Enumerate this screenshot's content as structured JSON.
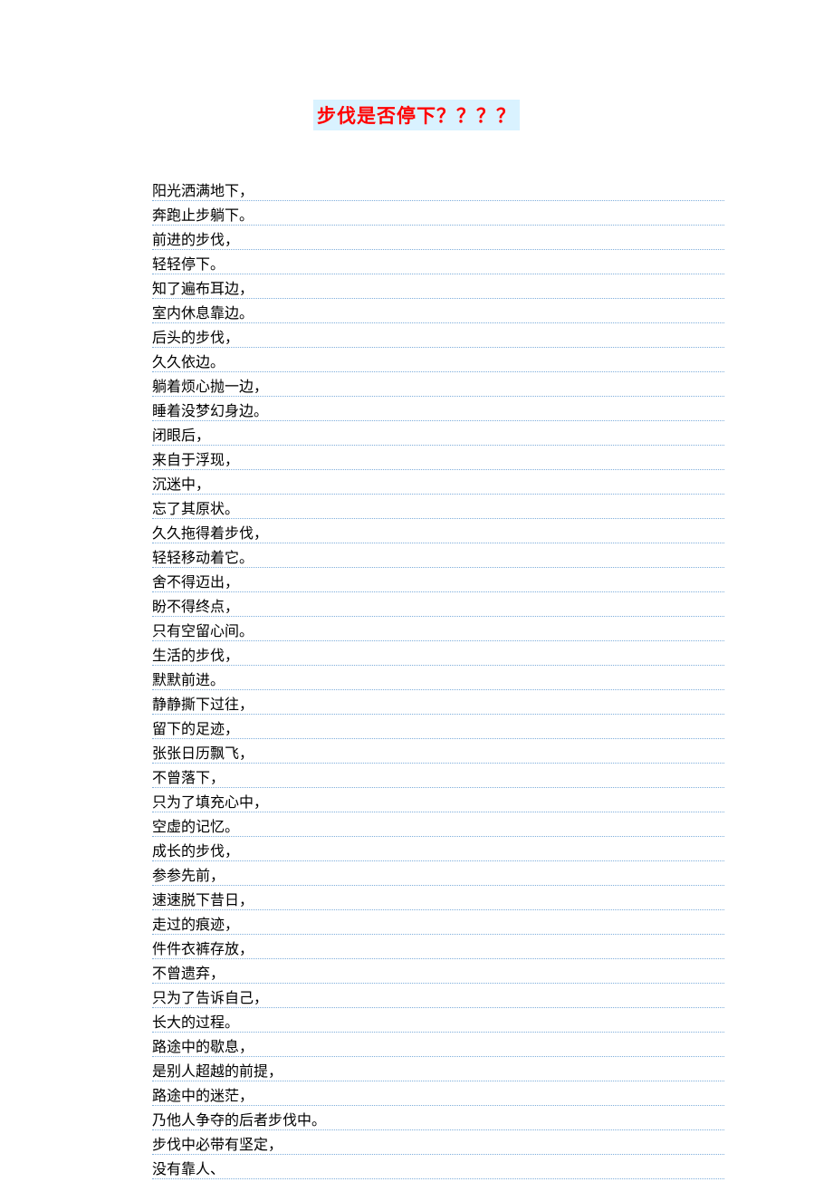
{
  "title": "步伐是否停下？？？？",
  "poem_lines": [
    "阳光洒满地下，",
    "奔跑止步躺下。",
    "前进的步伐，",
    "轻轻停下。",
    "知了遍布耳边，",
    "室内休息靠边。",
    "后头的步伐，",
    "久久依边。",
    "躺着烦心抛一边，",
    "睡着没梦幻身边。",
    "闭眼后，",
    "来自于浮现，",
    "沉迷中，",
    "忘了其原状。",
    "久久拖得着步伐，",
    "轻轻移动着它。",
    "舍不得迈出，",
    "盼不得终点，",
    "只有空留心间。",
    "生活的步伐，",
    "默默前进。",
    "静静撕下过往，",
    "留下的足迹，",
    "张张日历飘飞，",
    "不曾落下，",
    "只为了填充心中，",
    "空虚的记忆。",
    "成长的步伐，",
    "参参先前，",
    "速速脱下昔日，",
    "走过的痕迹，",
    "件件衣裤存放，",
    "不曾遗弃，",
    "只为了告诉自己，",
    "长大的过程。",
    "路途中的歇息，",
    "是别人超越的前提，",
    "路途中的迷茫，",
    "乃他人争夺的后者步伐中。",
    "步伐中必带有坚定，",
    "没有靠人、"
  ]
}
